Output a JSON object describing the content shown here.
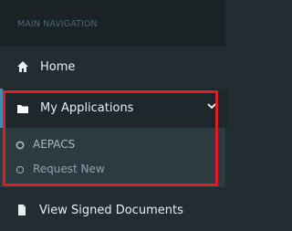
{
  "nav": {
    "header": "MAIN NAVIGATION",
    "items": [
      {
        "label": "Home",
        "icon": "home-icon"
      },
      {
        "label": "My Applications",
        "icon": "folder-icon",
        "caret": "chevron-down-icon",
        "children": [
          {
            "label": "AEPACS",
            "icon": "circle-icon"
          },
          {
            "label": "Request New",
            "icon": "circle-outline-icon"
          }
        ]
      },
      {
        "label": "View Signed Documents",
        "icon": "document-icon"
      }
    ]
  },
  "colors": {
    "sidebar_bg": "#222d32",
    "header_bg": "#1a2226",
    "active_bg": "#1e282c",
    "submenu_bg": "#2c3b41",
    "accent": "#3c8dbc",
    "highlight": "#e01c24"
  }
}
